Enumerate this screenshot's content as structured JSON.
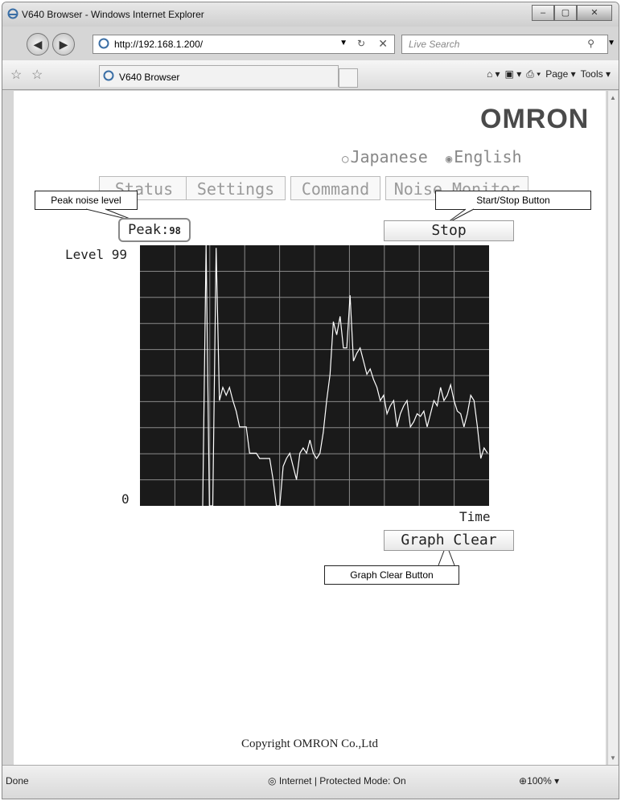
{
  "window": {
    "title": "V640 Browser - Windows Internet Explorer",
    "min": "–",
    "max": "▢",
    "close": "✕"
  },
  "address": {
    "url": "http://192.168.1.200/",
    "search_placeholder": "Live Search"
  },
  "tab": {
    "label": "V640 Browser"
  },
  "commands": {
    "page": "Page ▾",
    "tools": "Tools ▾"
  },
  "brand": {
    "logo": "OMRON"
  },
  "lang": {
    "japanese": "Japanese",
    "english": "English",
    "selected": "English"
  },
  "nav": {
    "status": "Status",
    "settings": "Settings",
    "command": "Command",
    "noise": "Noise Monitor"
  },
  "peak": {
    "label": "Peak:",
    "value": "98"
  },
  "buttons": {
    "stop": "Stop",
    "graph_clear": "Graph Clear"
  },
  "axis": {
    "level_label": "Level 99",
    "zero": "0",
    "time": "Time"
  },
  "callouts": {
    "peak": "Peak noise level",
    "startstop": "Start/Stop Button",
    "clear": "Graph Clear Button"
  },
  "footer": {
    "copyright": "Copyright OMRON Co.,Ltd"
  },
  "status": {
    "done": "Done",
    "zone": "Internet | Protected Mode: On",
    "zoom": "100%"
  },
  "chart_data": {
    "type": "line",
    "ylim": [
      0,
      99
    ],
    "grid": true,
    "series": [
      {
        "values": [
          0,
          99,
          0,
          0,
          98,
          40,
          45,
          42,
          45,
          40,
          36,
          30,
          30,
          30,
          20,
          20,
          20,
          18,
          18,
          18,
          18,
          10,
          0,
          0,
          15,
          18,
          20,
          15,
          10,
          20,
          22,
          20,
          25,
          20,
          18,
          20,
          28,
          40,
          50,
          70,
          65,
          72,
          60,
          60,
          80,
          55,
          58,
          60,
          55,
          50,
          52,
          48,
          45,
          40,
          42,
          35,
          38,
          40,
          30,
          35,
          38,
          40,
          30,
          32,
          35,
          34,
          36,
          30,
          35,
          40,
          38,
          45,
          40,
          42,
          46,
          40,
          36,
          35,
          30,
          35,
          42,
          40,
          30,
          18,
          22,
          20
        ]
      }
    ]
  }
}
